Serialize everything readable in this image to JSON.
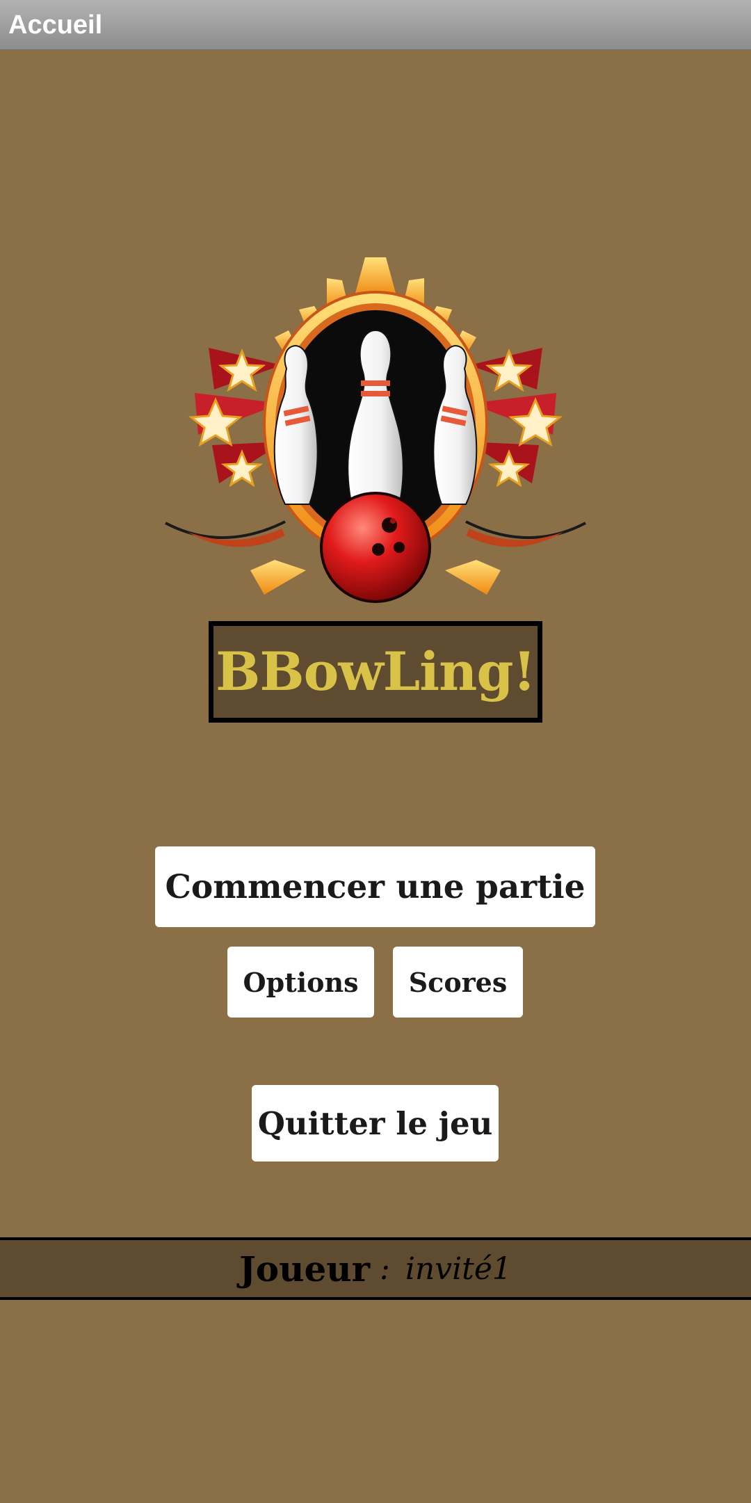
{
  "titlebar": {
    "title": "Accueil"
  },
  "logo": {
    "icon": "bowling-logo-icon"
  },
  "app": {
    "title": "BBowLing!"
  },
  "menu": {
    "start_label": "Commencer une partie",
    "options_label": "Options",
    "scores_label": "Scores",
    "quit_label": "Quitter le jeu"
  },
  "player": {
    "label": "Joueur",
    "separator": ":",
    "name": "invité1"
  },
  "colors": {
    "background": "#8a6f47",
    "panel": "#5f4b30",
    "title_text": "#d8c248",
    "button": "#ffffff"
  }
}
